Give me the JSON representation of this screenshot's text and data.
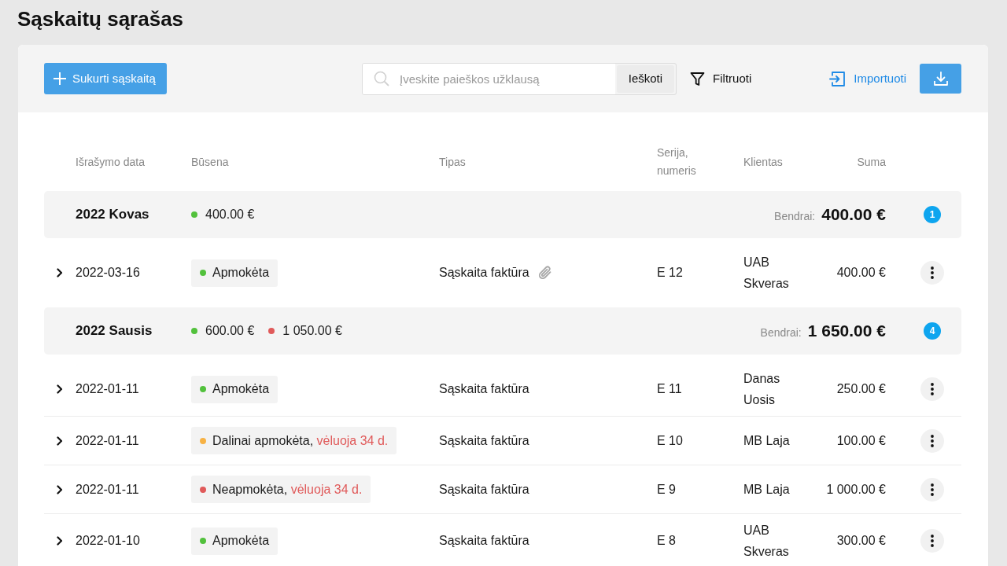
{
  "page": {
    "title": "Sąskaitų sąrašas"
  },
  "toolbar": {
    "create_button": "Sukurti sąskaitą",
    "search": {
      "placeholder": "Įveskite paieškos užklausą",
      "button": "Ieškoti"
    },
    "filter_button": "Filtruoti",
    "import_button": "Importuoti"
  },
  "table": {
    "columns": [
      "Išrašymo data",
      "Būsena",
      "Tipas",
      "Serija, numeris",
      "Klientas",
      "Suma"
    ],
    "groups": [
      {
        "label": "2022 Kovas",
        "sums": [
          {
            "amount": "400.00 €",
            "color": "#52c13c"
          }
        ],
        "total_label": "Bendrai:",
        "total": "400.00 €",
        "count": "1",
        "rows": [
          {
            "expanded": false,
            "date": "2022-03-16",
            "status": {
              "label": "Apmokėta",
              "color": "#52c13c"
            },
            "type": "Sąskaita faktūra",
            "attachment": true,
            "series": "E 12",
            "client": "UAB Skveras",
            "amount": "400.00 €"
          }
        ]
      },
      {
        "label": "2022 Sausis",
        "sums": [
          {
            "amount": "600.00 €",
            "color": "#52c13c"
          },
          {
            "amount": "1 050.00 €",
            "color": "#e05a5a"
          }
        ],
        "total_label": "Bendrai:",
        "total": "1 650.00 €",
        "count": "4",
        "rows": [
          {
            "expanded": false,
            "date": "2022-01-11",
            "status": {
              "label": "Apmokėta",
              "color": "#52c13c"
            },
            "type": "Sąskaita faktūra",
            "attachment": false,
            "series": "E 11",
            "client": "Danas Uosis",
            "amount": "250.00 €"
          },
          {
            "expanded": false,
            "date": "2022-01-11",
            "status": {
              "label": "Dalinai apmokėta,",
              "overdue": "vėluoja 34 d.",
              "color": "#f7b244"
            },
            "type": "Sąskaita faktūra",
            "attachment": false,
            "series": "E 10",
            "client": "MB Laja",
            "amount": "100.00 €"
          },
          {
            "expanded": false,
            "date": "2022-01-11",
            "status": {
              "label": "Neapmokėta,",
              "overdue": "vėluoja 34 d.",
              "color": "#e05a5a"
            },
            "type": "Sąskaita faktūra",
            "attachment": false,
            "series": "E 9",
            "client": "MB Laja",
            "amount": "1 000.00 €"
          },
          {
            "expanded": false,
            "date": "2022-01-10",
            "status": {
              "label": "Apmokėta",
              "color": "#52c13c"
            },
            "type": "Sąskaita faktūra",
            "attachment": false,
            "series": "E 8",
            "client": "UAB Skveras",
            "amount": "300.00 €"
          }
        ]
      }
    ]
  }
}
